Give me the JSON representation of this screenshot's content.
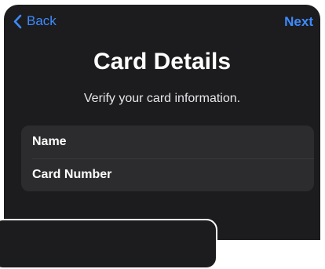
{
  "nav": {
    "back_label": "Back",
    "next_label": "Next"
  },
  "header": {
    "title": "Card Details",
    "subtitle": "Verify your card information."
  },
  "form": {
    "fields": [
      {
        "label": "Name"
      },
      {
        "label": "Card Number"
      }
    ]
  },
  "colors": {
    "background": "#1c1c1e",
    "accent": "#3d8bff",
    "group_background": "#2c2c2e"
  },
  "icons": {
    "back": "chevron-left-icon"
  }
}
